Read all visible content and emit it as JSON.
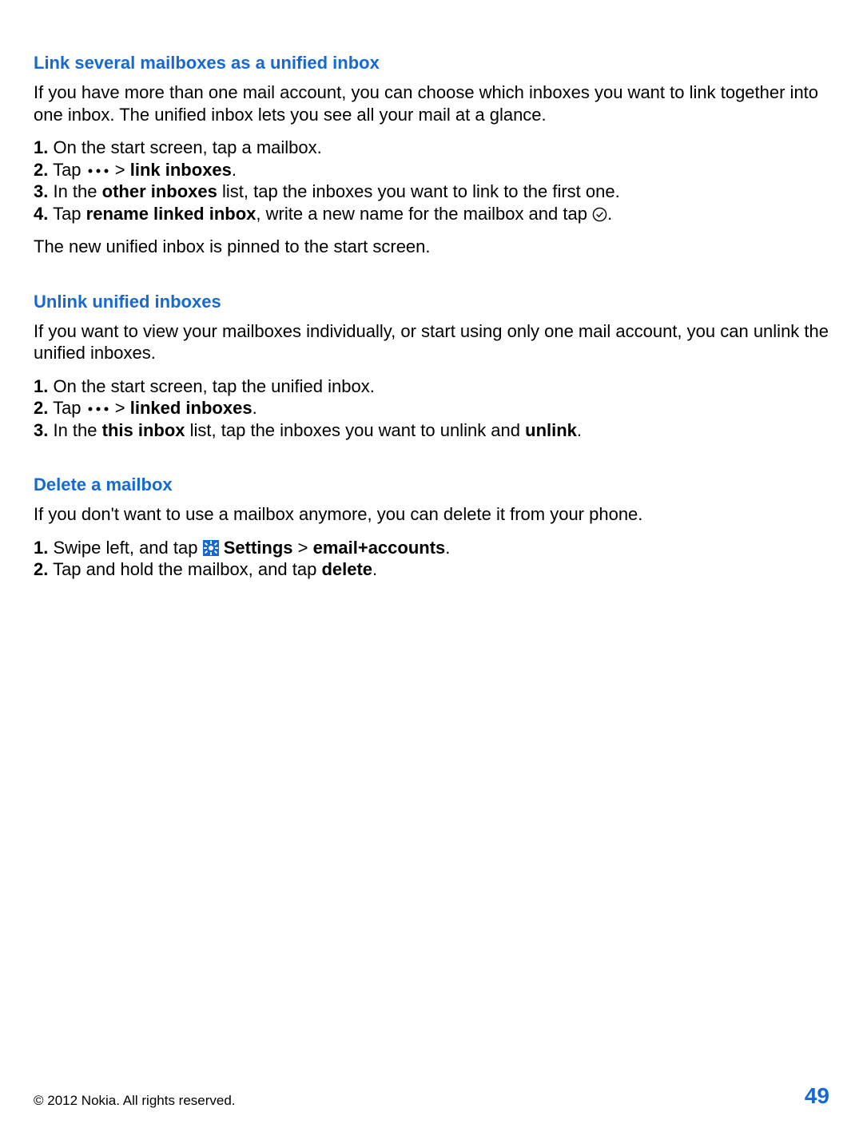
{
  "section1": {
    "heading": "Link several mailboxes as a unified inbox",
    "intro": "If you have more than one mail account, you can choose which inboxes you want to link together into one inbox. The unified inbox lets you see all your mail at a glance.",
    "step1_num": "1.",
    "step1_text": " On the start screen, tap a mailbox.",
    "step2_num": "2.",
    "step2_a": " Tap ",
    "step2_b": " > ",
    "step2_bold": "link inboxes",
    "step2_c": ".",
    "step3_num": "3.",
    "step3_a": " In the ",
    "step3_bold": "other inboxes",
    "step3_b": " list, tap the inboxes you want to link to the first one.",
    "step4_num": "4.",
    "step4_a": " Tap ",
    "step4_bold": "rename linked inbox",
    "step4_b": ", write a new name for the mailbox and tap ",
    "step4_c": ".",
    "outro": "The new unified inbox is pinned to the start screen."
  },
  "section2": {
    "heading": "Unlink unified inboxes",
    "intro": "If you want to view your mailboxes individually, or start using only one mail account, you can unlink the unified inboxes.",
    "step1_num": "1.",
    "step1_text": " On the start screen, tap the unified inbox.",
    "step2_num": "2.",
    "step2_a": " Tap ",
    "step2_b": " > ",
    "step2_bold": "linked inboxes",
    "step2_c": ".",
    "step3_num": "3.",
    "step3_a": " In the ",
    "step3_bold1": "this inbox",
    "step3_b": " list, tap the inboxes you want to unlink and ",
    "step3_bold2": "unlink",
    "step3_c": "."
  },
  "section3": {
    "heading": "Delete a mailbox",
    "intro": "If you don't want to use a mailbox anymore, you can delete it from your phone.",
    "step1_num": "1.",
    "step1_a": " Swipe left, and tap ",
    "step1_bold1": "Settings",
    "step1_b": " > ",
    "step1_bold2": "email+accounts",
    "step1_c": ".",
    "step2_num": "2.",
    "step2_a": " Tap and hold the mailbox, and tap ",
    "step2_bold": "delete",
    "step2_b": "."
  },
  "footer": {
    "copyright": "© 2012 Nokia. All rights reserved.",
    "page": "49"
  }
}
